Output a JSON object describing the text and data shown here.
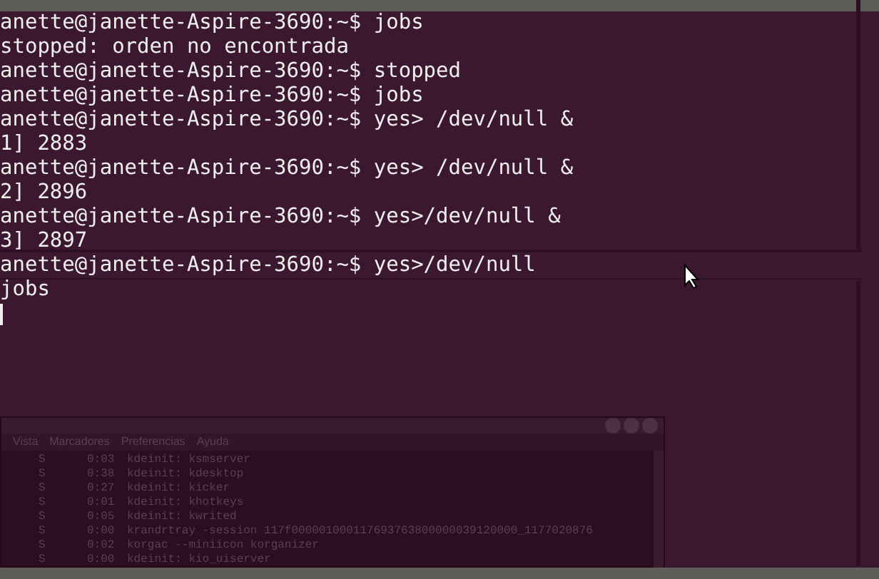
{
  "terminal": {
    "lines": [
      "anette@janette-Aspire-3690:~$ jobs",
      "stopped: orden no encontrada",
      "anette@janette-Aspire-3690:~$ stopped",
      "anette@janette-Aspire-3690:~$ jobs",
      "anette@janette-Aspire-3690:~$ yes> /dev/null &",
      "1] 2883",
      "anette@janette-Aspire-3690:~$ yes> /dev/null &",
      "2] 2896",
      "anette@janette-Aspire-3690:~$ yes>/dev/null &",
      "3] 2897",
      "anette@janette-Aspire-3690:~$ yes>/dev/null",
      "jobs"
    ],
    "cursor": true
  },
  "background_window": {
    "menu": [
      "Vista",
      "Marcadores",
      "Preferencias",
      "Ayuda"
    ],
    "rows": [
      {
        "state": "S",
        "time": "0:03",
        "command": "kdeinit: ksmserver"
      },
      {
        "state": "S",
        "time": "0:38",
        "command": "kdeinit: kdesktop"
      },
      {
        "state": "S",
        "time": "0:27",
        "command": "kdeinit: kicker"
      },
      {
        "state": "S",
        "time": "0:01",
        "command": "kdeinit: khotkeys"
      },
      {
        "state": "S",
        "time": "0:05",
        "command": "kdeinit: kwrited"
      },
      {
        "state": "S",
        "time": "0:00",
        "command": "krandrtray -session 117f000001000117693763800000039120000_1177020876"
      },
      {
        "state": "S",
        "time": "0:02",
        "command": "korgac --miniicon korganizer"
      },
      {
        "state": "S",
        "time": "0:00",
        "command": "kdeinit: kio_uiserver"
      }
    ]
  }
}
